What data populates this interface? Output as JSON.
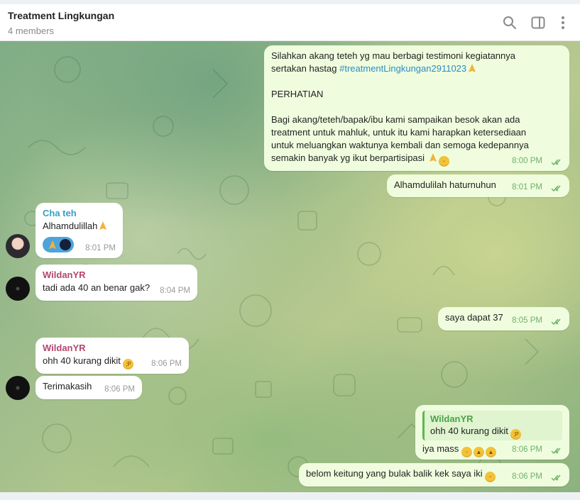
{
  "header": {
    "title": "Treatment Lingkungan",
    "subtitle": "4 members",
    "icons": [
      "search-icon",
      "sidebar-toggle-icon",
      "more-vertical-icon"
    ]
  },
  "messages": {
    "m1": {
      "line1": "Silahkan akang teteh yg mau berbagi testimoni kegiatannya",
      "line2_text": "sertakan hastag ",
      "line2_tag": "#treatmentLingkungan2911023",
      "line3": "PERHATIAN",
      "line4": "Bagi akang/teteh/bapak/ibu kami sampaikan besok akan ada",
      "line5": "treatment untuk mahluk, untuk itu kami harapkan ketersediaan",
      "line6": "untuk meluangkan waktunya kembali dan semoga kedepannya",
      "line7": "semakin banyak yg ikut berpartisipasi",
      "time": "8:00 PM"
    },
    "m2": {
      "text": "Alhamdulilah haturnuhun",
      "time": "8:01 PM"
    },
    "m3": {
      "sender": "Cha teh",
      "text": "Alhamdulillah",
      "time": "8:01 PM",
      "sender_color": "#3a9fc0"
    },
    "m4": {
      "sender": "WildanYR",
      "text": "tadi ada 40 an benar gak?",
      "time": "8:04 PM",
      "sender_color": "#b4466f"
    },
    "m5": {
      "text": "saya dapat 37",
      "time": "8:05 PM"
    },
    "m6": {
      "sender": "WildanYR",
      "text": "ohh 40 kurang dikit",
      "time": "8:06 PM",
      "sender_color": "#b4466f"
    },
    "m7": {
      "text": "Terimakasih",
      "time": "8:06 PM"
    },
    "m8": {
      "reply_sender": "WildanYR",
      "reply_text": "ohh 40 kurang dikit",
      "text": "iya mass",
      "time": "8:06 PM"
    },
    "m9": {
      "text": "belom keitung yang bulak balik kek saya iki",
      "time": "8:06 PM"
    }
  },
  "colors": {
    "outgoing_bubble": "#effdde",
    "incoming_bubble": "#ffffff",
    "outgoing_time": "#6fb16a",
    "hashtag": "#2a8bc8"
  }
}
